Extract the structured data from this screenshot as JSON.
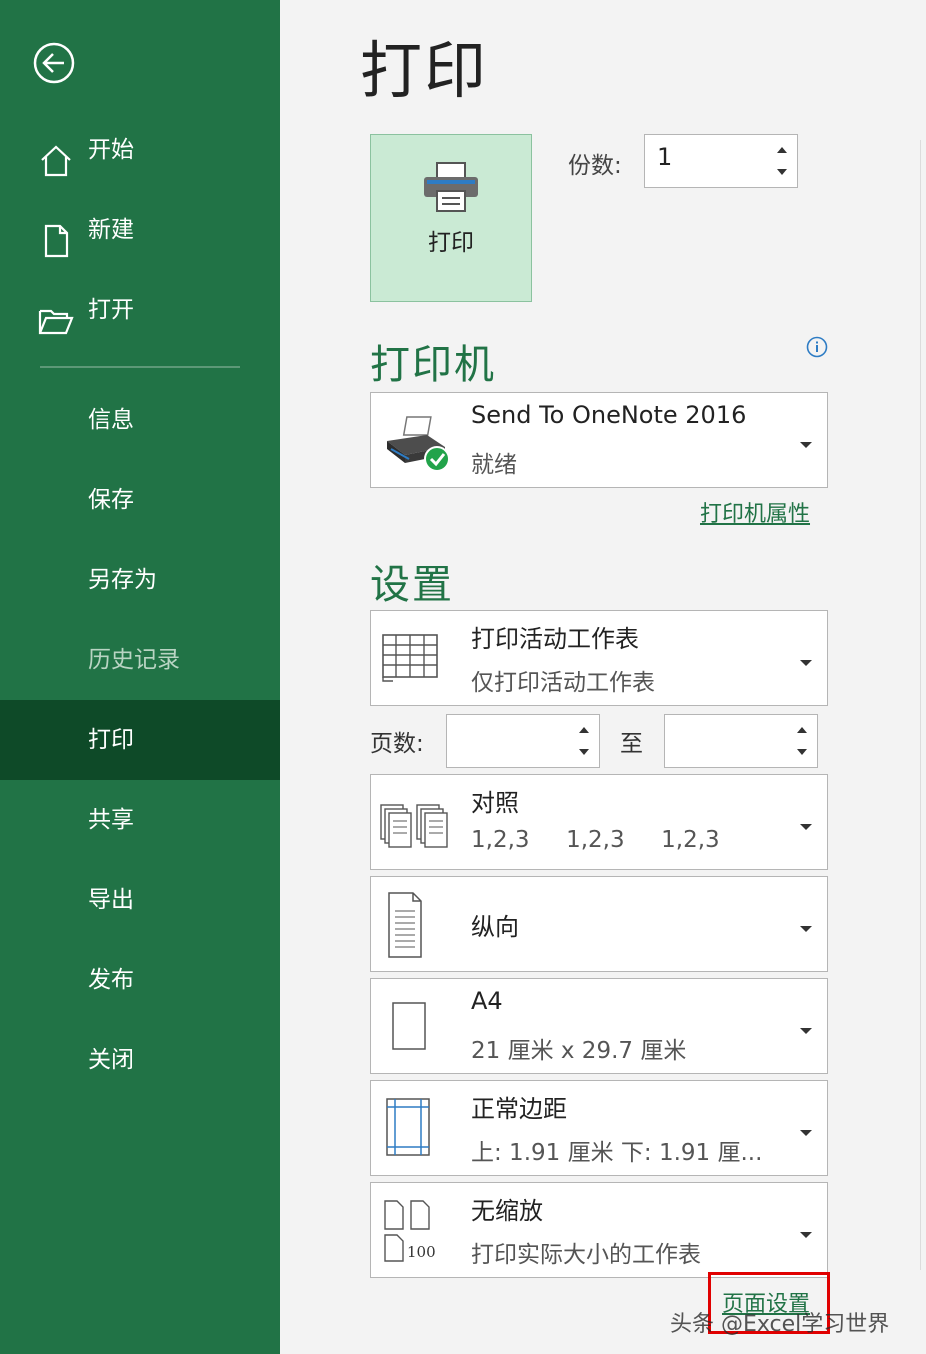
{
  "sidebar": {
    "back_icon": "back-arrow-icon",
    "items": [
      {
        "label": "开始",
        "icon": "home-icon"
      },
      {
        "label": "新建",
        "icon": "new-document-icon"
      },
      {
        "label": "打开",
        "icon": "open-folder-icon"
      },
      {
        "label": "信息"
      },
      {
        "label": "保存"
      },
      {
        "label": "另存为"
      },
      {
        "label": "历史记录"
      },
      {
        "label": "打印"
      },
      {
        "label": "共享"
      },
      {
        "label": "导出"
      },
      {
        "label": "发布"
      },
      {
        "label": "关闭"
      }
    ],
    "active": "打印",
    "disabled": "历史记录"
  },
  "main": {
    "title": "打印",
    "print_button_label": "打印",
    "copies_label": "份数:",
    "copies_value": "1",
    "printer_section_title": "打印机",
    "printer": {
      "name": "Send To OneNote 2016",
      "status": "就绪"
    },
    "printer_properties_link": "打印机属性",
    "settings_section_title": "设置",
    "settings": {
      "scope": {
        "title": "打印活动工作表",
        "subtitle": "仅打印活动工作表"
      },
      "pages_label": "页数:",
      "pages_from": "",
      "pages_to_label": "至",
      "pages_to": "",
      "collation": {
        "title": "对照",
        "subtitle": "1,2,3     1,2,3     1,2,3"
      },
      "orientation": {
        "title": "纵向"
      },
      "paper": {
        "title": "A4",
        "subtitle": "21 厘米 x 29.7 厘米"
      },
      "margins": {
        "title": "正常边距",
        "subtitle": "上: 1.91 厘米 下: 1.91 厘..."
      },
      "scaling": {
        "title": "无缩放",
        "subtitle": "打印实际大小的工作表",
        "icon_text": "100"
      }
    },
    "page_setup_link": "页面设置"
  },
  "watermark": "头条 @Excel学习世界",
  "colors": {
    "sidebar": "#217346",
    "active_item": "#0e4a28",
    "accent": "#217346",
    "highlight": "#e00000"
  }
}
